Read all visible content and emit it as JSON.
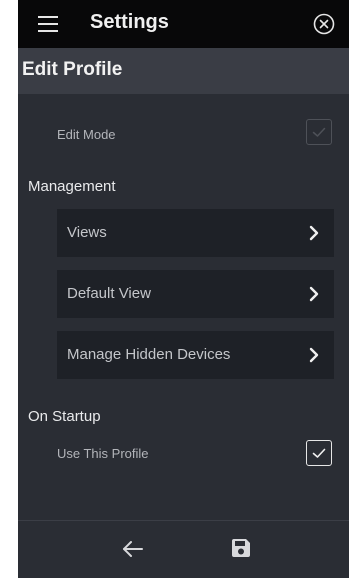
{
  "header": {
    "title": "Settings",
    "menu_icon": "hamburger-menu-icon",
    "close_icon": "close-circle-icon"
  },
  "subheader": {
    "title": "Edit Profile"
  },
  "edit_mode": {
    "label": "Edit Mode",
    "checked": true,
    "enabled": false
  },
  "management": {
    "title": "Management",
    "items": [
      {
        "label": "Views",
        "icon": "chevron-right-icon"
      },
      {
        "label": "Default View",
        "icon": "chevron-right-icon"
      },
      {
        "label": "Manage Hidden Devices",
        "icon": "chevron-right-icon"
      }
    ]
  },
  "startup": {
    "title": "On Startup",
    "use_profile": {
      "label": "Use This Profile",
      "checked": true
    }
  },
  "footer": {
    "back_icon": "arrow-left-icon",
    "save_icon": "save-floppy-icon"
  },
  "colors": {
    "background": "#2a2d34",
    "topbar": "#080809",
    "subheader": "#3a3d45",
    "menu_item": "#1e2127"
  }
}
